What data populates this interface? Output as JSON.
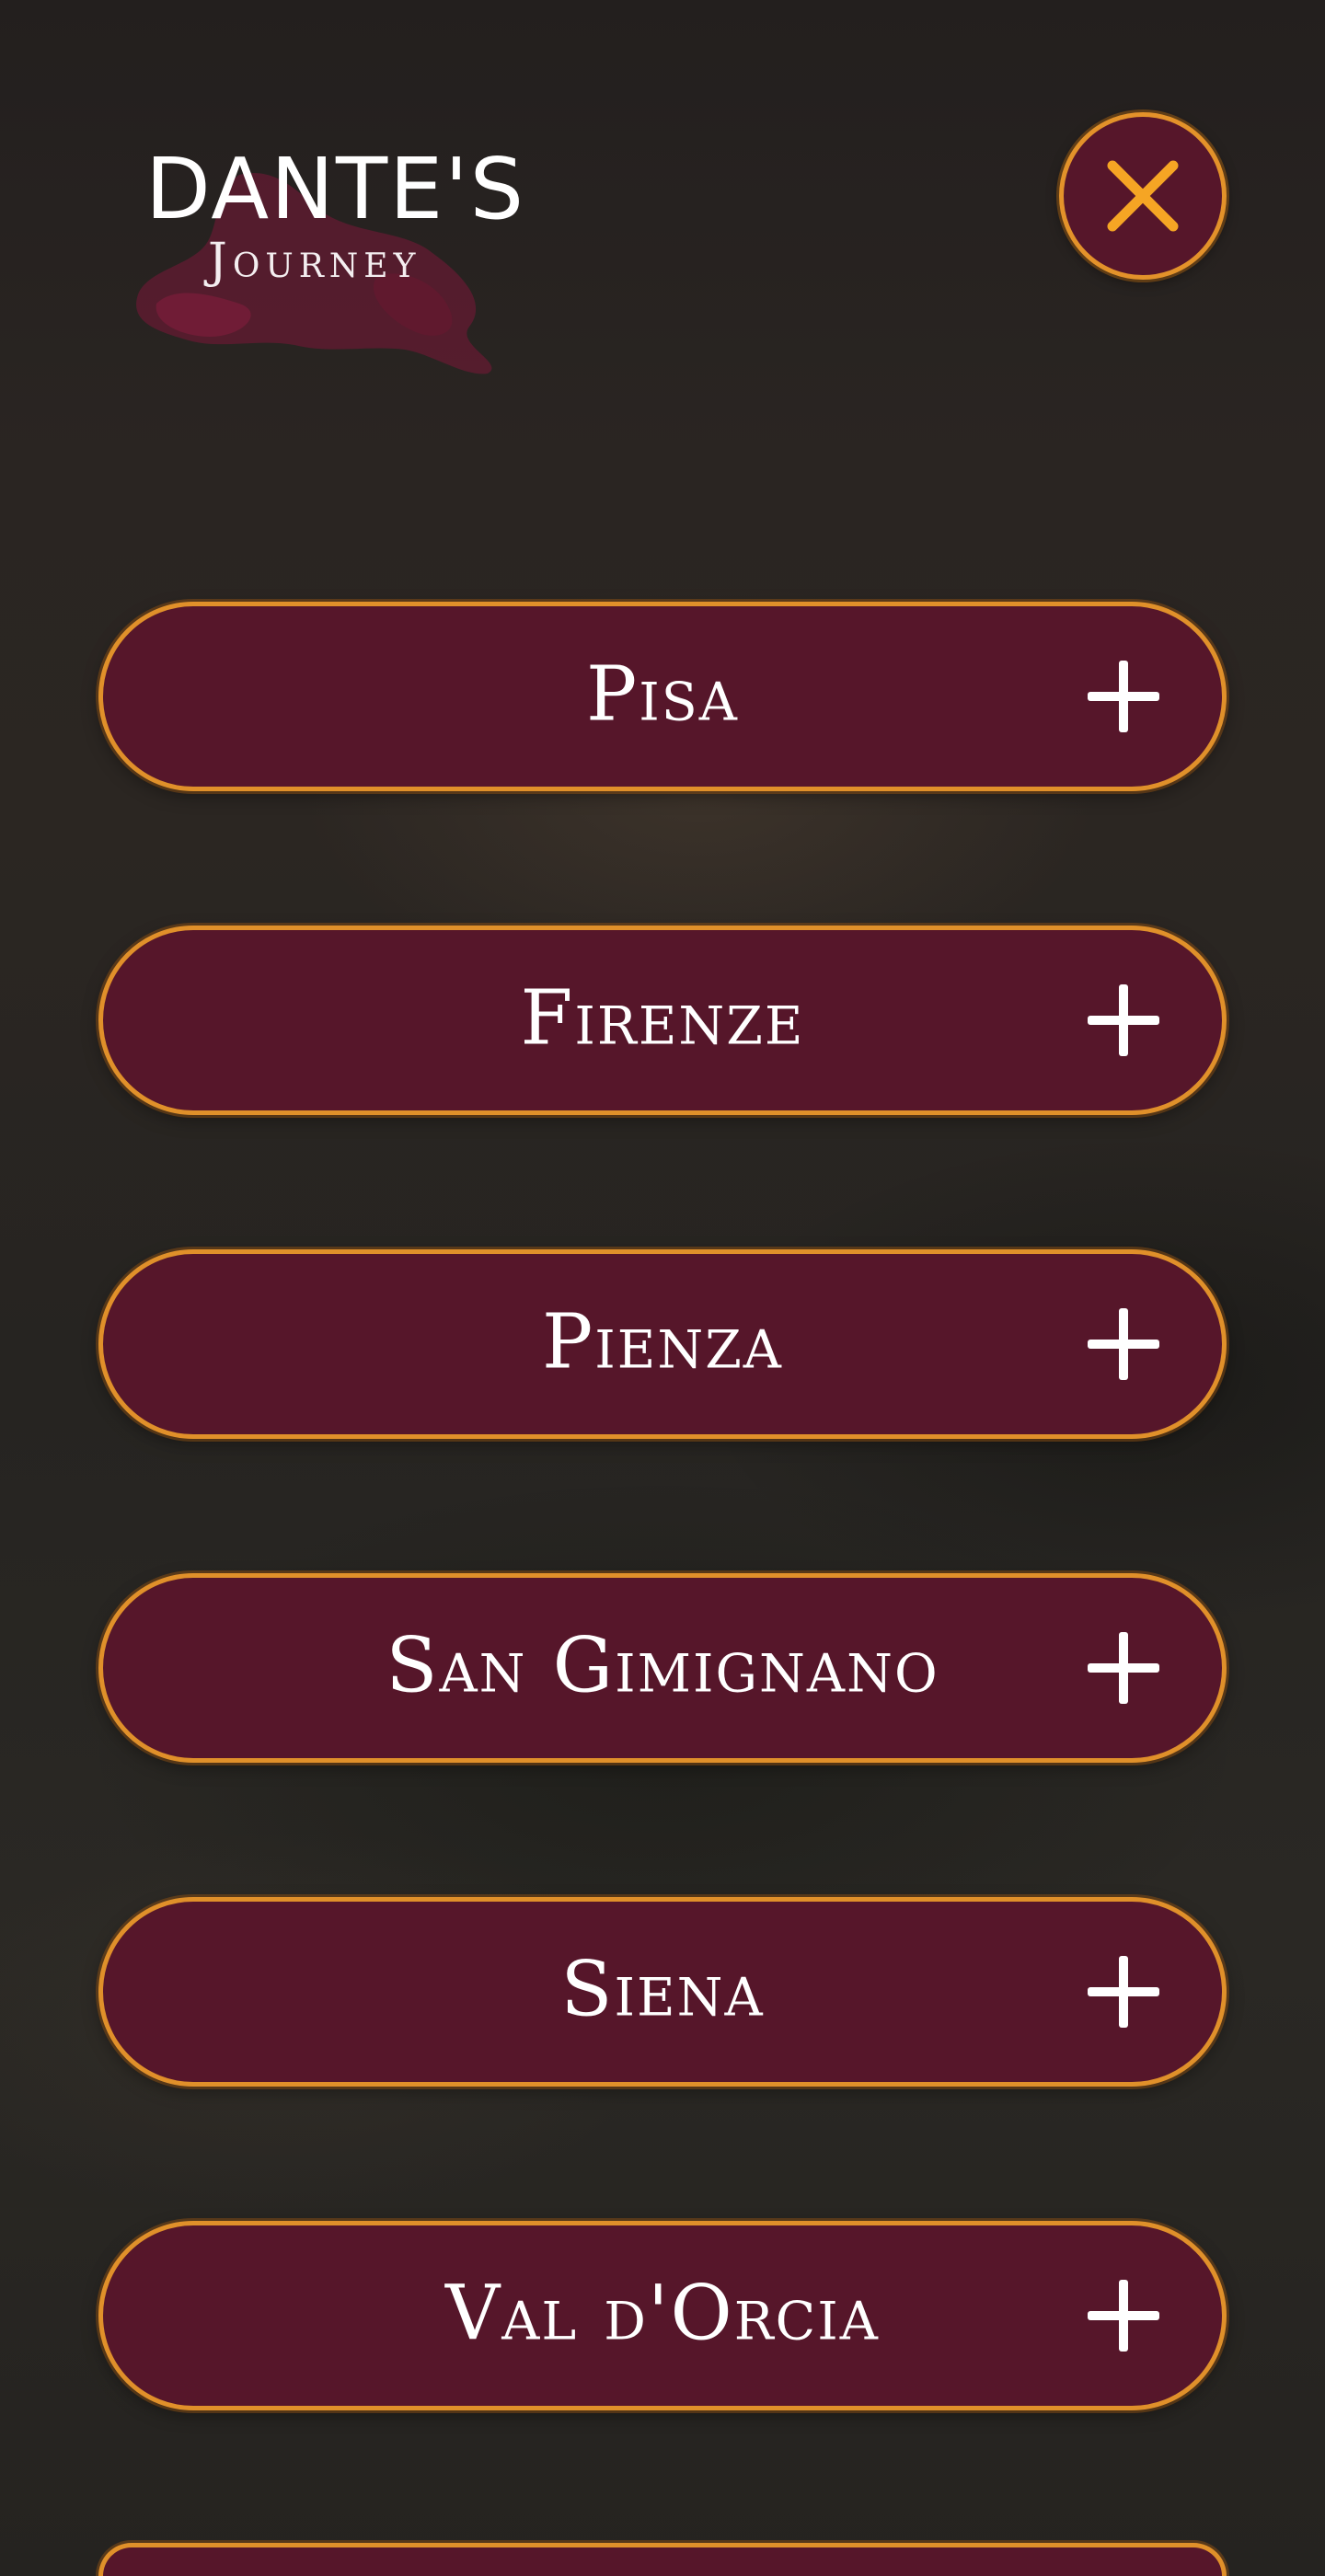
{
  "logo": {
    "title": "DANTE'S",
    "subtitle": "Journey"
  },
  "close_button": {
    "icon": "close-icon",
    "icon_color": "#f5a524"
  },
  "colors": {
    "button_fill": "#56162a",
    "button_border": "#e0902a",
    "background": "#272320"
  },
  "menu": {
    "items": [
      {
        "label": "Pisa",
        "icon": "plus-icon"
      },
      {
        "label": "Firenze",
        "icon": "plus-icon"
      },
      {
        "label": "Pienza",
        "icon": "plus-icon"
      },
      {
        "label": "San Gimignano",
        "icon": "plus-icon"
      },
      {
        "label": "Siena",
        "icon": "plus-icon"
      },
      {
        "label": "Val d'Orcia",
        "icon": "plus-icon"
      },
      {
        "label": "",
        "icon": "plus-icon"
      }
    ]
  }
}
